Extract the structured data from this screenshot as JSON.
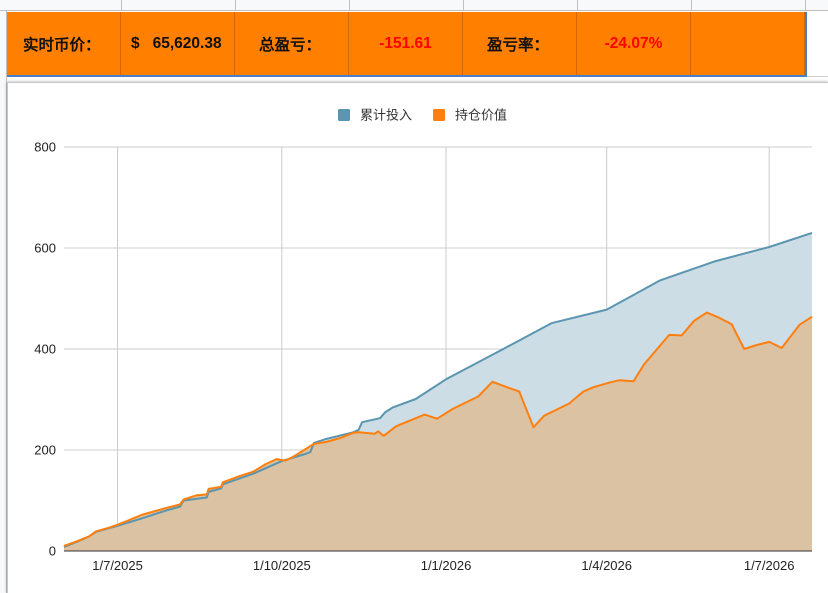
{
  "summary": {
    "price_label": "实时币价：",
    "currency_symbol": "$",
    "price_value": "65,620.38",
    "pnl_label": "总盈亏：",
    "pnl_value": "-151.61",
    "rate_label": "盈亏率：",
    "rate_value": "-24.07%"
  },
  "colors": {
    "header_bg": "#ff7f00",
    "negative": "#ff0000",
    "invested_line": "#5b95b0",
    "invested_fill": "#cddde6",
    "holding_line": "#ff7f0e",
    "holding_fill": "#dbc2a2"
  },
  "chart_data": {
    "type": "area",
    "title": "",
    "xlabel": "",
    "ylabel": "",
    "ylim": [
      0,
      800
    ],
    "yticks": [
      0,
      200,
      400,
      600,
      800
    ],
    "xlim": [
      "2025-06-01",
      "2026-07-25"
    ],
    "xticks": [
      {
        "date": "2025-07-01",
        "label": "1/7/2025"
      },
      {
        "date": "2025-10-01",
        "label": "1/10/2025"
      },
      {
        "date": "2026-01-01",
        "label": "1/1/2026"
      },
      {
        "date": "2026-04-01",
        "label": "1/4/2026"
      },
      {
        "date": "2026-07-01",
        "label": "1/7/2026"
      }
    ],
    "grid": true,
    "legend": "top-center",
    "series": [
      {
        "name": "累计投入",
        "color": "#5b95b0",
        "points": [
          [
            "2025-06-01",
            8
          ],
          [
            "2025-06-08",
            18
          ],
          [
            "2025-06-15",
            29
          ],
          [
            "2025-06-19",
            38
          ],
          [
            "2025-06-26",
            45
          ],
          [
            "2025-07-01",
            50
          ],
          [
            "2025-07-15",
            65
          ],
          [
            "2025-07-29",
            81
          ],
          [
            "2025-08-05",
            88
          ],
          [
            "2025-08-07",
            100
          ],
          [
            "2025-08-20",
            106
          ],
          [
            "2025-08-21",
            117
          ],
          [
            "2025-08-28",
            124
          ],
          [
            "2025-08-29",
            132
          ],
          [
            "2025-09-15",
            153
          ],
          [
            "2025-10-01",
            178
          ],
          [
            "2025-10-15",
            193
          ],
          [
            "2025-10-17",
            196
          ],
          [
            "2025-10-19",
            214
          ],
          [
            "2025-10-25",
            221
          ],
          [
            "2025-11-10",
            235
          ],
          [
            "2025-11-13",
            240
          ],
          [
            "2025-11-15",
            255
          ],
          [
            "2025-11-25",
            263
          ],
          [
            "2025-11-28",
            275
          ],
          [
            "2025-12-02",
            284
          ],
          [
            "2025-12-15",
            301
          ],
          [
            "2026-01-01",
            340
          ],
          [
            "2026-02-01",
            398
          ],
          [
            "2026-03-01",
            451
          ],
          [
            "2026-04-01",
            478
          ],
          [
            "2026-05-01",
            536
          ],
          [
            "2026-06-01",
            574
          ],
          [
            "2026-07-01",
            602
          ],
          [
            "2026-07-25",
            630
          ]
        ]
      },
      {
        "name": "持仓价值",
        "color": "#ff7f0e",
        "points": [
          [
            "2025-06-01",
            10
          ],
          [
            "2025-06-08",
            19
          ],
          [
            "2025-06-15",
            29
          ],
          [
            "2025-06-19",
            39
          ],
          [
            "2025-06-26",
            46
          ],
          [
            "2025-07-01",
            52
          ],
          [
            "2025-07-08",
            62
          ],
          [
            "2025-07-15",
            72
          ],
          [
            "2025-07-29",
            86
          ],
          [
            "2025-08-05",
            92
          ],
          [
            "2025-08-07",
            102
          ],
          [
            "2025-08-14",
            110
          ],
          [
            "2025-08-20",
            112
          ],
          [
            "2025-08-21",
            123
          ],
          [
            "2025-08-28",
            127
          ],
          [
            "2025-08-29",
            136
          ],
          [
            "2025-09-07",
            148
          ],
          [
            "2025-09-15",
            157
          ],
          [
            "2025-09-22",
            172
          ],
          [
            "2025-09-28",
            182
          ],
          [
            "2025-10-03",
            179
          ],
          [
            "2025-10-08",
            188
          ],
          [
            "2025-10-19",
            212
          ],
          [
            "2025-10-26",
            216
          ],
          [
            "2025-11-03",
            224
          ],
          [
            "2025-11-10",
            234
          ],
          [
            "2025-11-13",
            235
          ],
          [
            "2025-11-22",
            232
          ],
          [
            "2025-11-24",
            237
          ],
          [
            "2025-11-27",
            228
          ],
          [
            "2025-12-04",
            247
          ],
          [
            "2025-12-20",
            270
          ],
          [
            "2025-12-27",
            262
          ],
          [
            "2026-01-05",
            282
          ],
          [
            "2026-01-19",
            306
          ],
          [
            "2026-01-27",
            335
          ],
          [
            "2026-02-06",
            322
          ],
          [
            "2026-02-11",
            316
          ],
          [
            "2026-02-19",
            245
          ],
          [
            "2026-02-25",
            268
          ],
          [
            "2026-03-11",
            292
          ],
          [
            "2026-03-19",
            316
          ],
          [
            "2026-03-25",
            325
          ],
          [
            "2026-04-03",
            334
          ],
          [
            "2026-04-08",
            338
          ],
          [
            "2026-04-16",
            336
          ],
          [
            "2026-04-22",
            370
          ],
          [
            "2026-05-06",
            428
          ],
          [
            "2026-05-13",
            427
          ],
          [
            "2026-05-20",
            456
          ],
          [
            "2026-05-27",
            472
          ],
          [
            "2026-06-03",
            462
          ],
          [
            "2026-06-10",
            449
          ],
          [
            "2026-06-17",
            400
          ],
          [
            "2026-06-24",
            408
          ],
          [
            "2026-07-01",
            414
          ],
          [
            "2026-07-08",
            402
          ],
          [
            "2026-07-18",
            448
          ],
          [
            "2026-07-25",
            464
          ]
        ]
      }
    ]
  }
}
